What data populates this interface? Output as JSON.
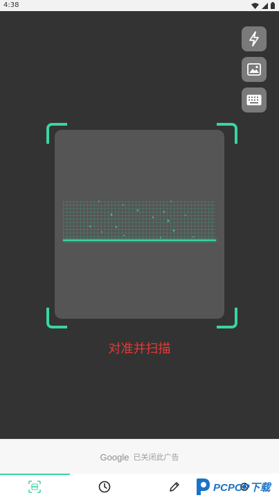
{
  "status_bar": {
    "time": "4:38"
  },
  "scanner": {
    "hint": "对准并扫描",
    "accent_color": "#38d6a0",
    "hint_color": "#e53935",
    "side_buttons": [
      "flash-icon",
      "image-gallery-icon",
      "keyboard-icon"
    ]
  },
  "ad": {
    "brand": "Google",
    "closed_text": "已关闭此广告"
  },
  "bottom_nav": {
    "items": [
      {
        "icon": "scan-icon",
        "active": true
      },
      {
        "icon": "history-clock-icon",
        "active": false
      },
      {
        "icon": "create-pencil-icon",
        "active": false
      },
      {
        "icon": "settings-gear-icon",
        "active": false
      }
    ]
  },
  "watermark": {
    "text": "PCPOP下载"
  }
}
